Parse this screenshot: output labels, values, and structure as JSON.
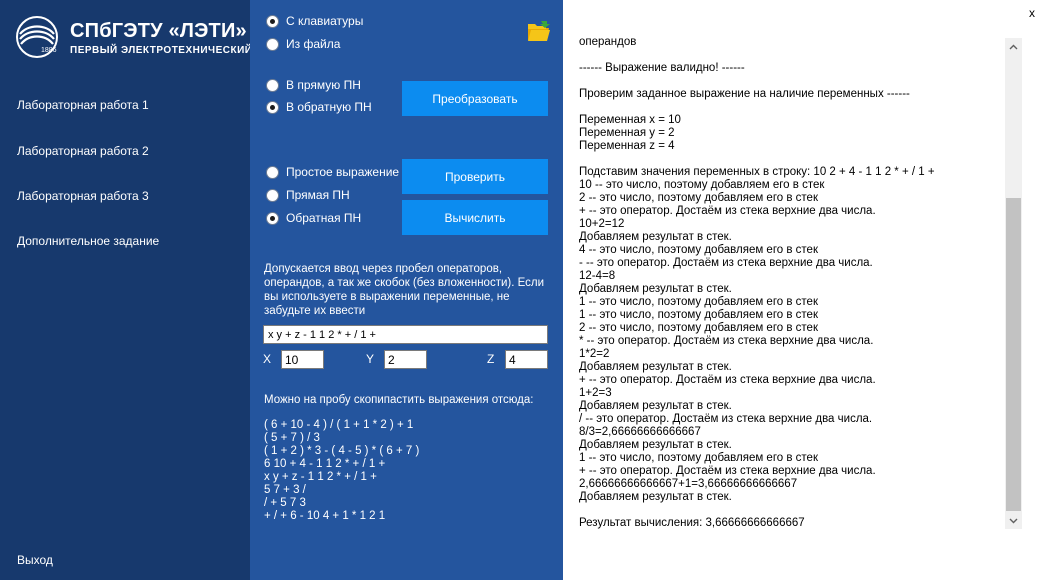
{
  "sidebar": {
    "logo_title": "СПбГЭТУ «ЛЭТИ»",
    "logo_subtitle": "ПЕРВЫЙ ЭЛЕКТРОТЕХНИЧЕСКИЙ",
    "logo_year": "1886",
    "items": [
      {
        "label": "Лабораторная работа 1"
      },
      {
        "label": "Лабораторная работа 2"
      },
      {
        "label": "Лабораторная работа 3"
      },
      {
        "label": "Дополнительное задание"
      }
    ],
    "exit_label": "Выход"
  },
  "input_source": {
    "options": [
      "С клавиатуры",
      "Из файла"
    ],
    "selected": 0
  },
  "convert_group": {
    "options": [
      "В прямую ПН",
      "В обратную ПН"
    ],
    "selected": 1,
    "button_label": "Преобразовать"
  },
  "expr_type_group": {
    "options": [
      "Простое выражение",
      "Прямая ПН",
      "Обратная ПН"
    ],
    "selected": 2,
    "check_label": "Проверить",
    "calc_label": "Вычислить"
  },
  "hint_text": "Допускается ввод через пробел операторов, операндов, а так же скобок (без вложенности). Если вы используете в выражении переменные, не забудьте их ввести",
  "expression_value": "x y + z - 1 1 2 * + / 1 +",
  "variables": {
    "x_label": "X",
    "x_value": "10",
    "y_label": "Y",
    "y_value": "2",
    "z_label": "Z",
    "z_value": "4"
  },
  "examples_title": "Можно на пробу скопипастить выражения отсюда:",
  "examples": [
    "( 6 + 10 - 4 ) / ( 1 + 1 * 2 ) + 1",
    "( 5 + 7 ) / 3",
    "( 1 + 2 ) * 3 - ( 4 - 5 ) * ( 6 + 7 )",
    "6 10 + 4 - 1 1 2 * + / 1 +",
    "x y + z - 1 1 2 * + / 1 +",
    "5 7 + 3 /",
    "/ + 5 7 3",
    "+ / + 6 - 10 4 + 1 * 1 2 1"
  ],
  "output_lines": [
    "операндов",
    "",
    "------ Выражение валидно! ------",
    "",
    "Проверим заданное выражение на наличие переменных ------",
    "",
    "Переменная x = 10",
    "Переменная y = 2",
    "Переменная z = 4",
    "",
    "Подставим значения переменных в строку: 10 2 + 4 - 1 1 2 * + / 1 +",
    "10 -- это число, поэтому добавляем его в стек",
    "2 -- это число, поэтому добавляем его в стек",
    "+ -- это оператор. Достаём из стека верхние два числа.",
    "10+2=12",
    "Добавляем результат в стек.",
    "4 -- это число, поэтому добавляем его в стек",
    "- -- это оператор. Достаём из стека верхние два числа.",
    "12-4=8",
    "Добавляем результат в стек.",
    "1 -- это число, поэтому добавляем его в стек",
    "1 -- это число, поэтому добавляем его в стек",
    "2 -- это число, поэтому добавляем его в стек",
    "* -- это оператор. Достаём из стека верхние два числа.",
    "1*2=2",
    "Добавляем результат в стек.",
    "+ -- это оператор. Достаём из стека верхние два числа.",
    "1+2=3",
    "Добавляем результат в стек.",
    "/ -- это оператор. Достаём из стека верхние два числа.",
    "8/3=2,66666666666667",
    "Добавляем результат в стек.",
    "1 -- это число, поэтому добавляем его в стек",
    "+ -- это оператор. Достаём из стека верхние два числа.",
    "2,66666666666667+1=3,66666666666667",
    "Добавляем результат в стек.",
    "",
    "Результат вычисления: 3,66666666666667"
  ],
  "close_label": "x",
  "icons": {
    "folder": "folder-open-icon",
    "scroll_up": "chevron-up-icon",
    "scroll_down": "chevron-down-icon",
    "logo": "university-logo-icon"
  },
  "colors": {
    "sidebar": "#17396d",
    "panel": "#24559e",
    "button": "#0c8cf0",
    "folder": "#f5c518"
  }
}
